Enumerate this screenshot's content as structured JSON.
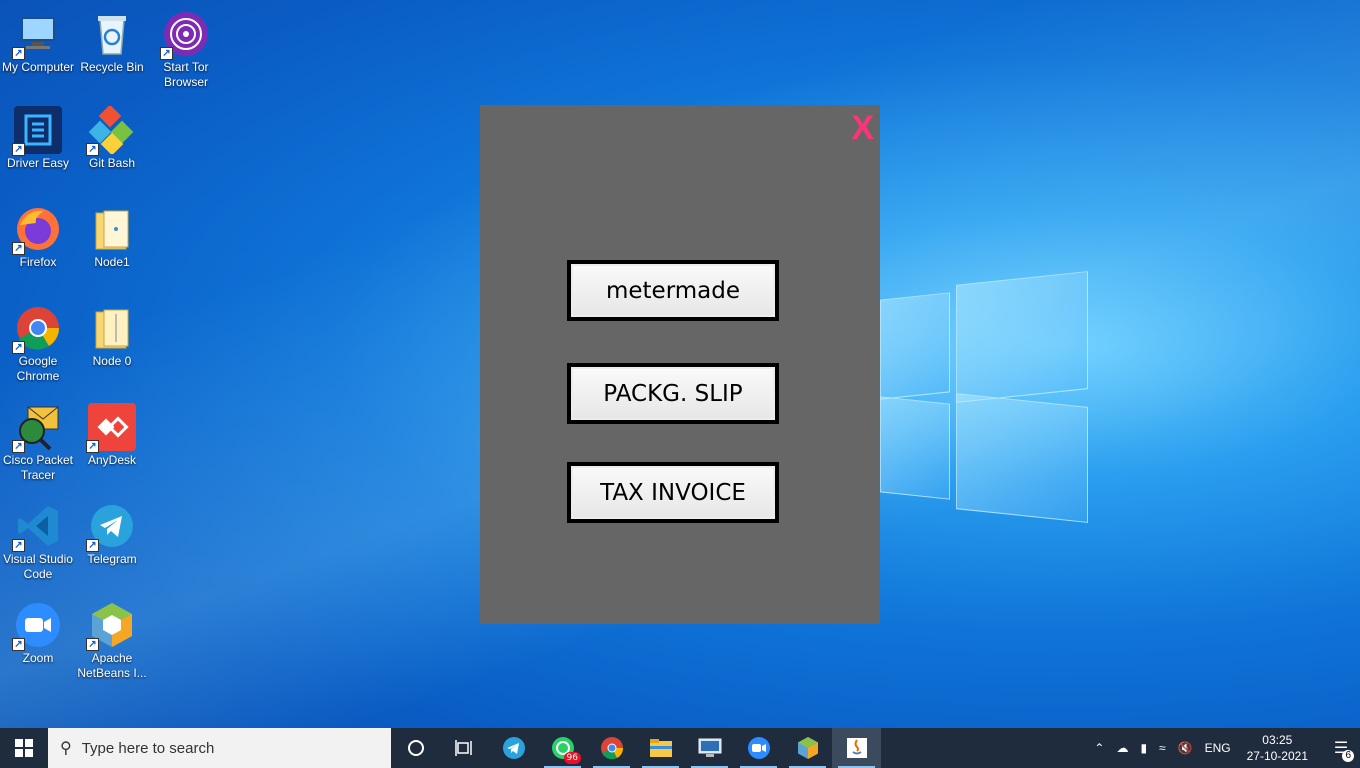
{
  "desktop_icons": [
    {
      "label": "My Computer",
      "icon": "computer-icon"
    },
    {
      "label": "Recycle Bin",
      "icon": "recycle-bin-icon"
    },
    {
      "label": "Start Tor Browser",
      "icon": "tor-browser-icon"
    },
    {
      "label": "Driver Easy",
      "icon": "driver-easy-icon"
    },
    {
      "label": "Git Bash",
      "icon": "git-bash-icon"
    },
    {
      "label": "Firefox",
      "icon": "firefox-icon"
    },
    {
      "label": "Node1",
      "icon": "folder-icon"
    },
    {
      "label": "Google Chrome",
      "icon": "chrome-icon"
    },
    {
      "label": "Node 0",
      "icon": "folder-icon"
    },
    {
      "label": "Cisco Packet Tracer",
      "icon": "packet-tracer-icon"
    },
    {
      "label": "AnyDesk",
      "icon": "anydesk-icon"
    },
    {
      "label": "Visual Studio Code",
      "icon": "vscode-icon"
    },
    {
      "label": "Telegram",
      "icon": "telegram-icon"
    },
    {
      "label": "Zoom",
      "icon": "zoom-icon"
    },
    {
      "label": "Apache NetBeans I...",
      "icon": "netbeans-icon"
    }
  ],
  "dialog": {
    "close_label": "X",
    "buttons": [
      "metermade",
      "PACKG. SLIP",
      "TAX INVOICE"
    ]
  },
  "taskbar": {
    "search_placeholder": "Type here to search",
    "whatsapp_badge": "96",
    "language": "ENG",
    "time": "03:25",
    "date": "27-10-2021",
    "notifications": "6"
  },
  "colors": {
    "dialog_bg": "#666666",
    "close": "#ff3377",
    "taskbar": "#1e2c3d"
  }
}
